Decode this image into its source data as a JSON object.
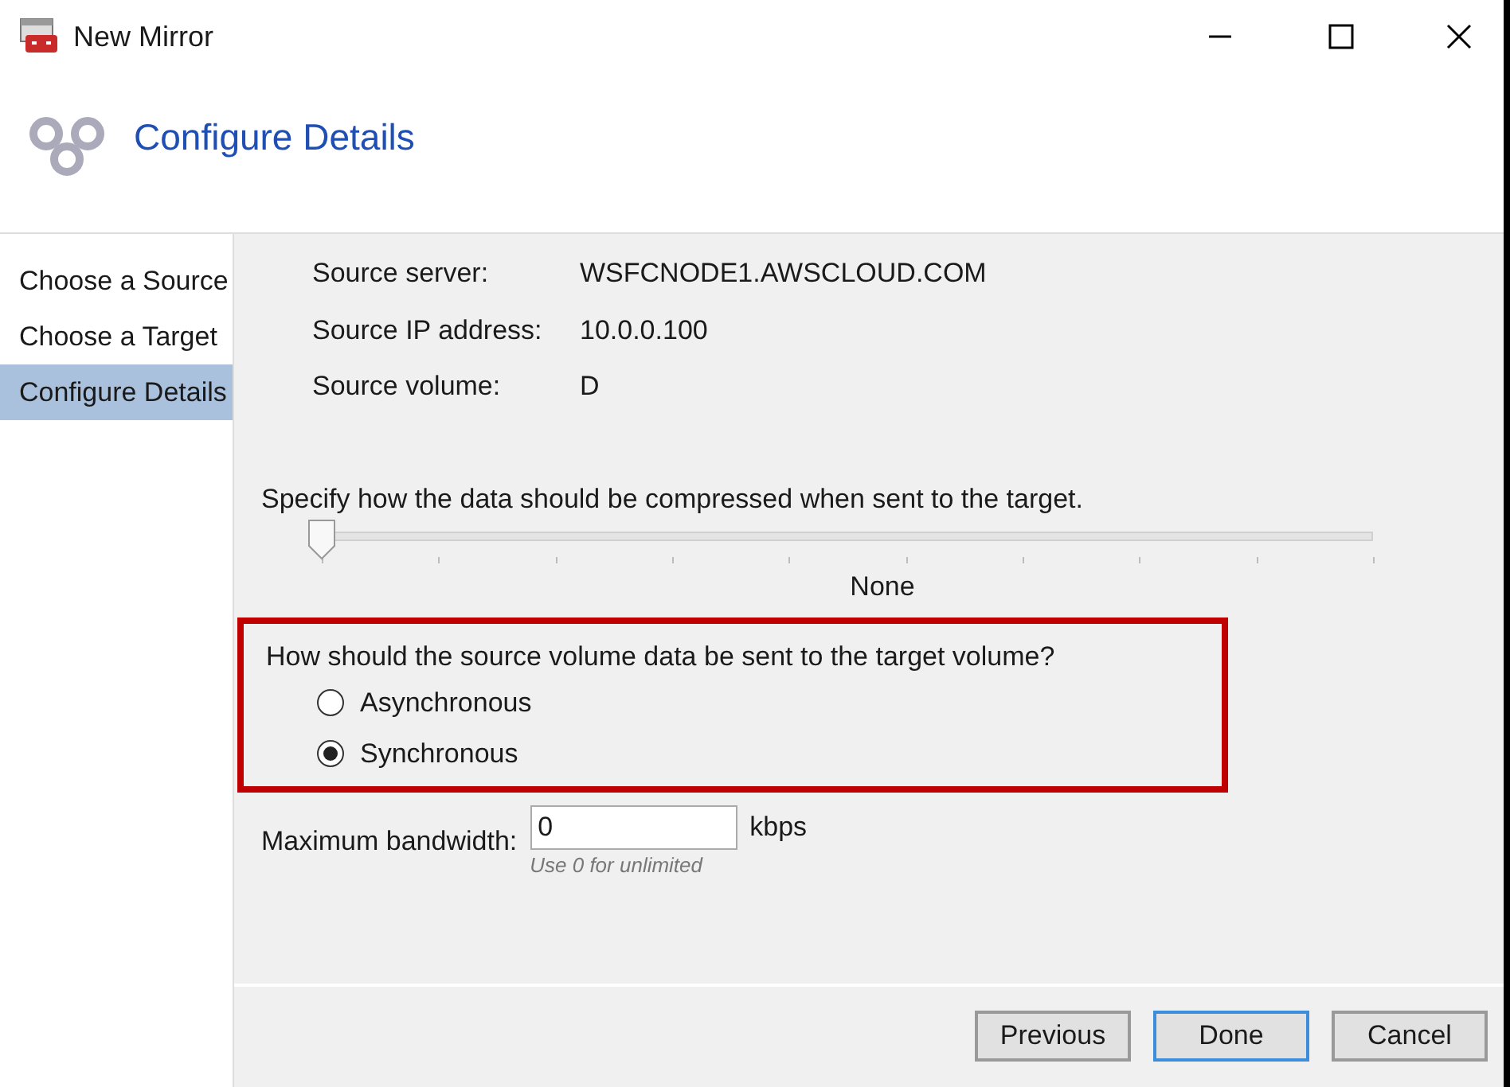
{
  "window": {
    "title": "New Mirror"
  },
  "header": {
    "title": "Configure Details"
  },
  "sidebar": {
    "items": [
      {
        "label": "Choose a Source",
        "selected": false
      },
      {
        "label": "Choose a Target",
        "selected": false
      },
      {
        "label": "Configure Details",
        "selected": true
      }
    ]
  },
  "details": [
    {
      "label": "Source server:",
      "value": "WSFCNODE1.AWSCLOUD.COM"
    },
    {
      "label": "Source IP address:",
      "value": "10.0.0.100"
    },
    {
      "label": "Source volume:",
      "value": "D"
    }
  ],
  "compression": {
    "label": "Specify how the data should be compressed when sent to the target.",
    "level": 0,
    "reading": "None"
  },
  "mode": {
    "question": "How should the source volume data be sent to the target volume?",
    "options": [
      {
        "label": "Asynchronous",
        "selected": false
      },
      {
        "label": "Synchronous",
        "selected": true
      }
    ]
  },
  "bandwidth": {
    "label": "Maximum bandwidth:",
    "value": "0",
    "unit": "kbps",
    "hint": "Use 0 for unlimited"
  },
  "buttons": [
    {
      "label": "Previous",
      "default": false
    },
    {
      "label": "Done",
      "default": true
    },
    {
      "label": "Cancel",
      "default": false
    }
  ]
}
